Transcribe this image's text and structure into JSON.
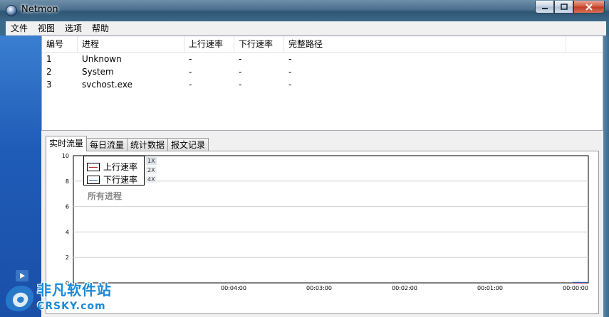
{
  "window": {
    "title": "Netmon",
    "buttons": {
      "minimize": "minimize",
      "maximize": "maximize",
      "close": "close"
    }
  },
  "menu": [
    "文件",
    "视图",
    "选项",
    "帮助"
  ],
  "process_list": {
    "columns": [
      "编号",
      "进程",
      "上行速率",
      "下行速率",
      "完整路径",
      ""
    ],
    "rows": [
      [
        "1",
        "Unknown",
        "-",
        "-",
        "-"
      ],
      [
        "2",
        "System",
        "-",
        "-",
        "-"
      ],
      [
        "3",
        "svchost.exe",
        "-",
        "-",
        "-"
      ]
    ]
  },
  "tabs": [
    "实时流量",
    "每日流量",
    "统计数据",
    "报文记录"
  ],
  "active_tab": "实时流量",
  "chart_data": {
    "type": "line",
    "title": "",
    "subtitle": "所有进程",
    "ylim": [
      0,
      10
    ],
    "y_ticks": [
      "10",
      "8",
      "6",
      "4",
      "2",
      "0"
    ],
    "x_ticks": [
      "00:04:00",
      "00:03:00",
      "00:02:00",
      "00:01:00",
      "00:00:00"
    ],
    "grid": true,
    "legend_position": "top-left",
    "series": [
      {
        "name": "上行速率",
        "color": "#c8282a",
        "x": [
          "00:00:00"
        ],
        "values": [
          0
        ]
      },
      {
        "name": "下行速率",
        "color": "#2a5aa8",
        "x": [
          "00:00:00"
        ],
        "values": [
          0
        ]
      }
    ],
    "zoom_options": [
      "1X",
      "2X",
      "4X"
    ],
    "zoom_selected": "1X"
  },
  "watermark": {
    "main": "非凡软件站",
    "sub": "CRSKY.com"
  }
}
